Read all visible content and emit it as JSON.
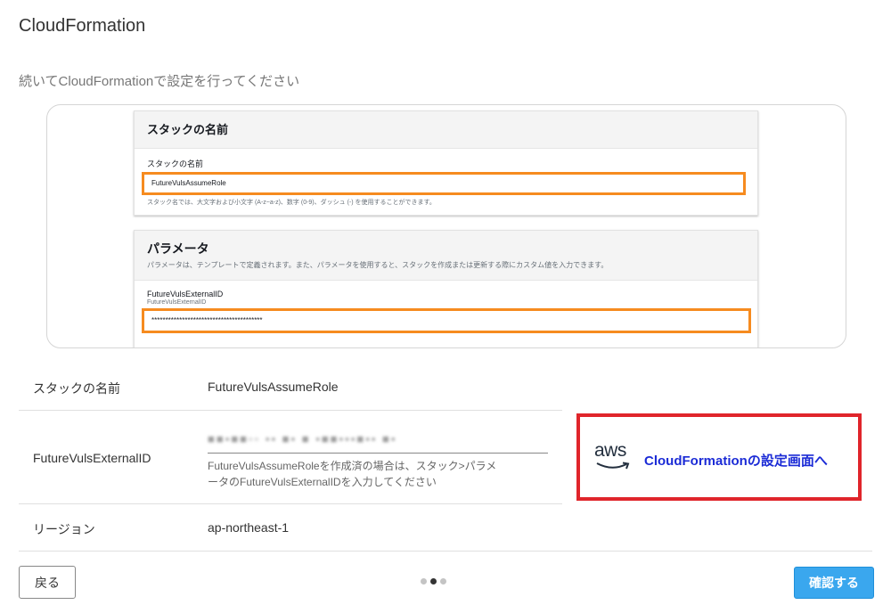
{
  "page": {
    "title": "CloudFormation",
    "subtitle": "続いてCloudFormationで設定を行ってください"
  },
  "preview": {
    "stack_section_title": "スタックの名前",
    "stack_field_label": "スタックの名前",
    "stack_field_value": "FutureVulsAssumeRole",
    "stack_field_hint": "スタック名では、大文字および小文字 (A-z~a-z)、数字 (0-9)、ダッシュ (-) を使用することができます。",
    "params_section_title": "パラメータ",
    "params_section_desc": "パラメータは、テンプレートで定義されます。また、パラメータを使用すると、スタックを作成または更新する際にカスタム値を入力できます。",
    "param_label": "FutureVulsExternalID",
    "param_sublabel": "FutureVulsExternalID",
    "param_value": "****************************************"
  },
  "info": {
    "stack_name_label": "スタックの名前",
    "stack_name_value": "FutureVulsAssumeRole",
    "external_id_label": "FutureVulsExternalID",
    "external_id_value": "■■▪■■▫▫ ▪▪ ■▪ ■ ▪■■▪▪▪■▪▪ ■▪",
    "external_id_help": "FutureVulsAssumeRoleを作成済の場合は、スタック>パラメータのFutureVulsExternalIDを入力してください",
    "region_label": "リージョン",
    "region_value": "ap-northeast-1"
  },
  "aws_button": {
    "logo_text": "aws",
    "link_label": "CloudFormationの設定画面へ",
    "link_color": "#1b2bd6",
    "border_color": "#e0252b"
  },
  "footer": {
    "back_label": "戻る",
    "confirm_label": "確認する",
    "step_current": 2,
    "step_total": 3
  }
}
